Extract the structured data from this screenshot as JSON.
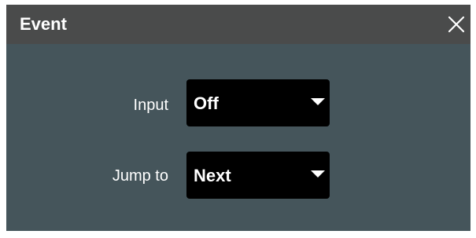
{
  "dialog": {
    "title": "Event"
  },
  "fields": [
    {
      "label": "Input",
      "value": "Off"
    },
    {
      "label": "Jump to",
      "value": "Next"
    }
  ],
  "icons": {
    "close": "close-icon",
    "dropdown": "caret-down-icon"
  },
  "colors": {
    "title_bar": "#4a4b4b",
    "dialog_body": "#45555b",
    "select_bg": "#000000",
    "text": "#ffffff"
  }
}
